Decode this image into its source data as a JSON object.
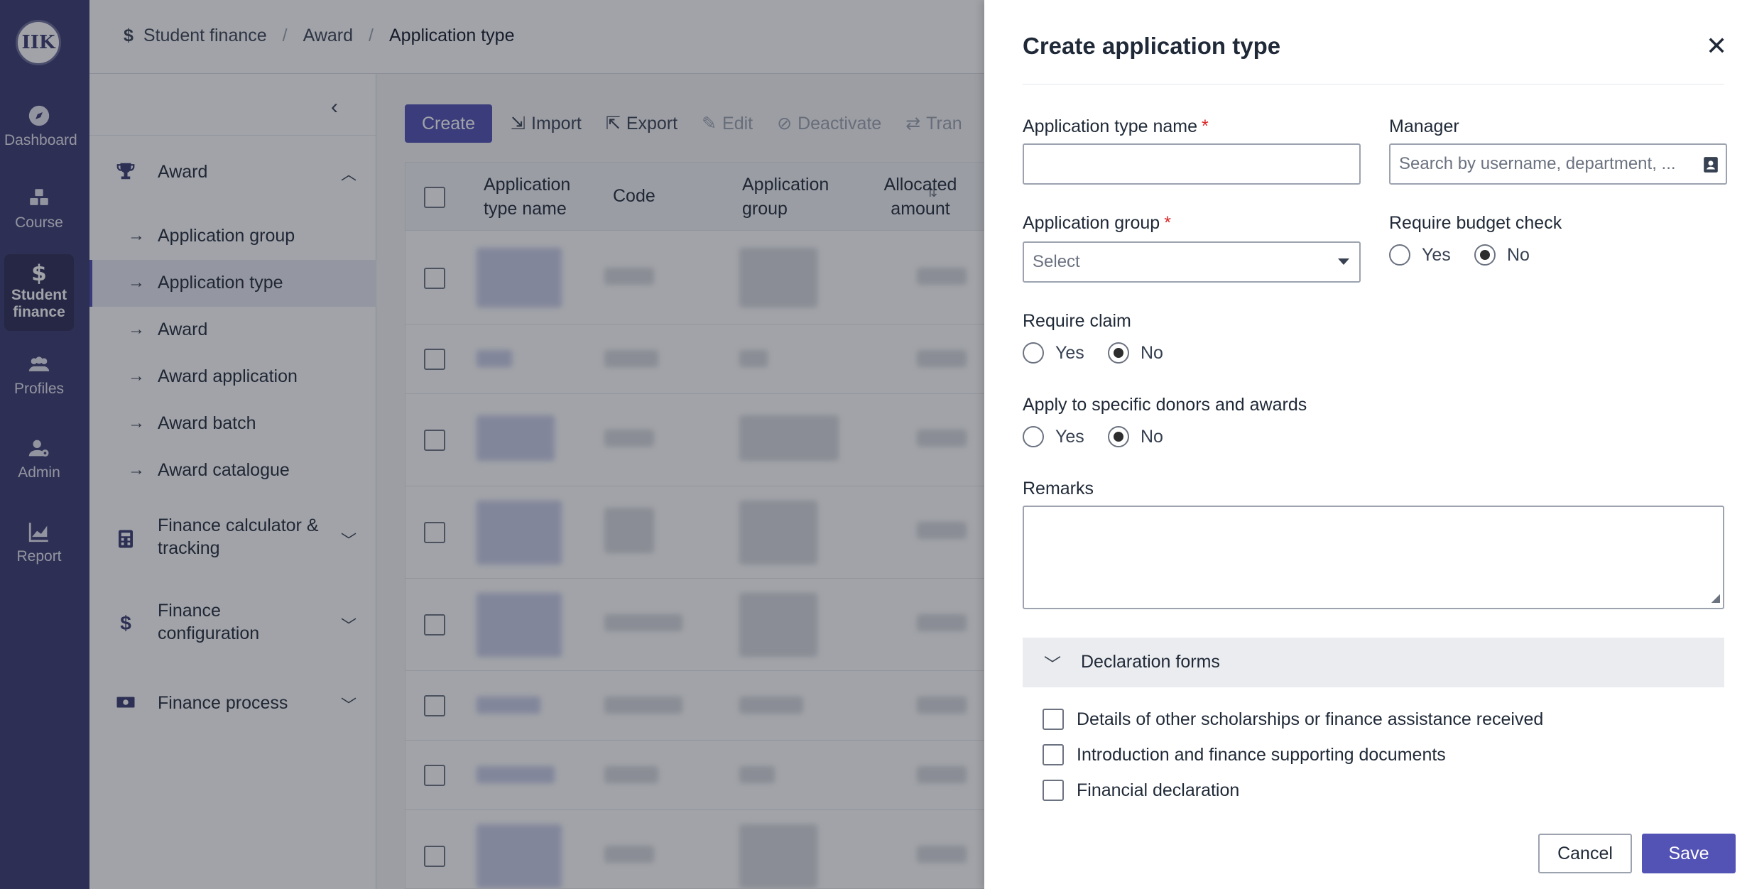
{
  "rail": {
    "logo_text": "IIK",
    "items": [
      {
        "label": "Dashboard",
        "icon": "compass-icon"
      },
      {
        "label": "Course",
        "icon": "cubes-icon"
      },
      {
        "label": "Student finance",
        "icon": "dollar-icon"
      },
      {
        "label": "Profiles",
        "icon": "users-icon"
      },
      {
        "label": "Admin",
        "icon": "user-gear-icon"
      },
      {
        "label": "Report",
        "icon": "chart-icon"
      }
    ]
  },
  "breadcrumb": {
    "items": [
      "Student finance",
      "Award",
      "Application type"
    ],
    "separator": "/"
  },
  "subnav": {
    "groups": [
      {
        "label": "Award",
        "icon": "trophy-icon",
        "expanded": true
      },
      {
        "label": "Finance calculator & tracking",
        "icon": "calculator-icon"
      },
      {
        "label": "Finance configuration",
        "icon": "dollar-icon"
      },
      {
        "label": "Finance process",
        "icon": "cash-icon"
      }
    ],
    "award_items": [
      "Application group",
      "Application type",
      "Award",
      "Award application",
      "Award batch",
      "Award catalogue"
    ],
    "active_item": "Application type"
  },
  "toolbar": {
    "create": "Create",
    "import": "Import",
    "export": "Export",
    "edit": "Edit",
    "deactivate": "Deactivate",
    "transfer": "Tran"
  },
  "table": {
    "headers": [
      "Application type name",
      "Code",
      "Application group",
      "Allocated amount"
    ]
  },
  "drawer": {
    "title": "Create application type",
    "fields": {
      "name_label": "Application type name",
      "name_value": "",
      "manager_label": "Manager",
      "manager_placeholder": "Search by username, department, ...",
      "group_label": "Application group",
      "group_placeholder": "Select",
      "budget_label": "Require budget check",
      "claim_label": "Require claim",
      "donors_label": "Apply to specific donors and awards",
      "remarks_label": "Remarks",
      "yes": "Yes",
      "no": "No"
    },
    "declaration": {
      "title": "Declaration forms",
      "items": [
        "Details of other scholarships or finance assistance received",
        "Introduction and finance supporting documents",
        "Financial declaration"
      ]
    },
    "cancel": "Cancel",
    "save": "Save"
  },
  "colors": {
    "rail_bg": "#38386f",
    "primary": "#4e4eb1",
    "required": "#dc2626"
  }
}
